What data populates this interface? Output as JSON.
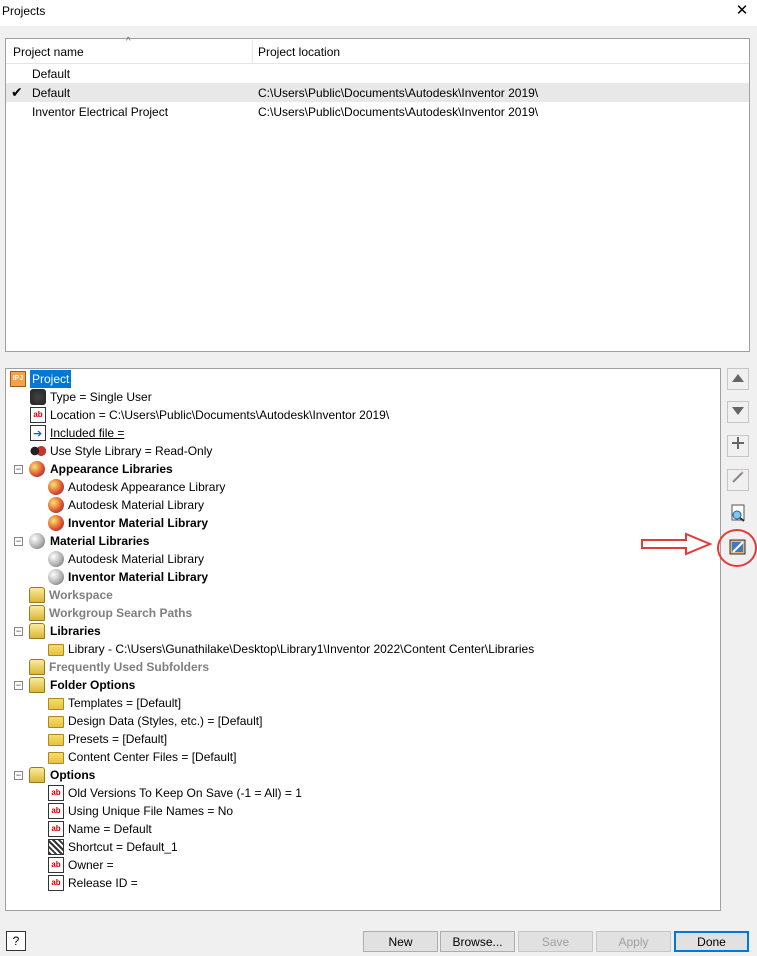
{
  "window": {
    "title": "Projects",
    "close_glyph": "✕"
  },
  "project_list": {
    "columns": {
      "name": "Project name",
      "location": "Project location"
    },
    "rows": [
      {
        "name": "Default",
        "location": "",
        "active": false
      },
      {
        "name": "Default",
        "location": "C:\\Users\\Public\\Documents\\Autodesk\\Inventor 2019\\",
        "active": true
      },
      {
        "name": "Inventor Electrical Project",
        "location": "C:\\Users\\Public\\Documents\\Autodesk\\Inventor 2019\\",
        "active": false
      }
    ]
  },
  "tree": {
    "project": "Project",
    "type": "Type = Single User",
    "location": "Location = C:\\Users\\Public\\Documents\\Autodesk\\Inventor 2019\\",
    "included_file": "Included file =",
    "use_style_library": "Use Style Library = Read-Only",
    "appearance_libraries": {
      "label": "Appearance Libraries",
      "items": [
        "Autodesk Appearance Library",
        "Autodesk Material Library",
        "Inventor Material Library"
      ]
    },
    "material_libraries": {
      "label": "Material Libraries",
      "items": [
        "Autodesk Material Library",
        "Inventor Material Library"
      ]
    },
    "workspace": "Workspace",
    "workgroup_search_paths": "Workgroup Search Paths",
    "libraries": {
      "label": "Libraries",
      "items": [
        "Library - C:\\Users\\Gunathilake\\Desktop\\Library1\\Inventor 2022\\Content Center\\Libraries"
      ]
    },
    "frequently_used_subfolders": "Frequently Used Subfolders",
    "folder_options": {
      "label": "Folder Options",
      "items": [
        "Templates = [Default]",
        "Design Data (Styles, etc.) = [Default]",
        "Presets = [Default]",
        "Content Center Files = [Default]"
      ]
    },
    "options": {
      "label": "Options",
      "items": [
        "Old Versions To Keep On Save (-1 = All) = 1",
        "Using Unique File Names = No",
        "Name = Default",
        "Shortcut = Default_1",
        "Owner =",
        "Release ID ="
      ]
    }
  },
  "side_buttons": [
    "up-arrow-icon",
    "down-arrow-icon",
    "add-icon",
    "edit-icon",
    "find-icon",
    "edit-project-icon"
  ],
  "buttons": {
    "help": "?",
    "new": "New",
    "browse": "Browse...",
    "save": "Save",
    "apply": "Apply",
    "done": "Done"
  },
  "annotation_color": "#e23a3a",
  "selection_color": "#0078d7"
}
